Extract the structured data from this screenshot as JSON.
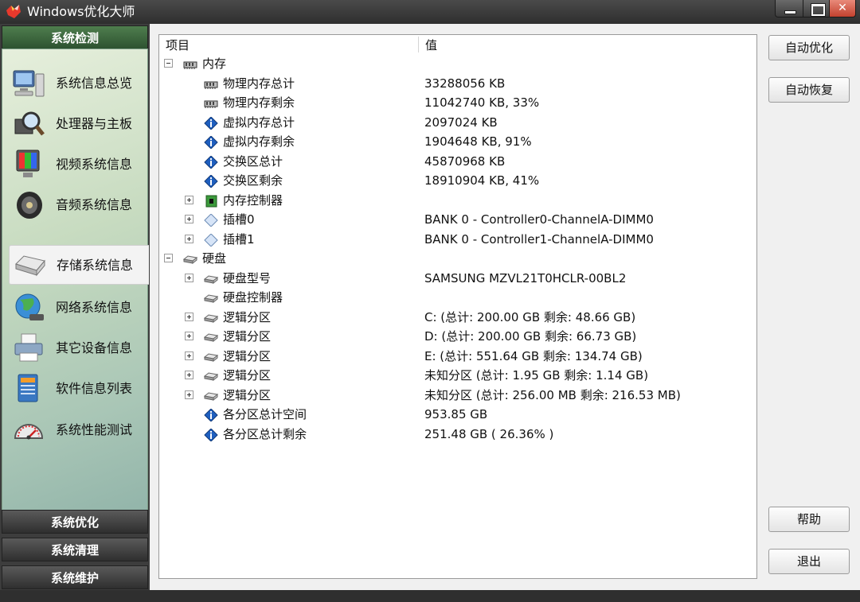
{
  "window": {
    "title": "Windows优化大师",
    "controls": [
      "minimize",
      "maximize",
      "close"
    ]
  },
  "sidebar": {
    "categories": [
      {
        "label": "系统检测",
        "active": true
      },
      {
        "label": "系统优化",
        "active": false
      },
      {
        "label": "系统清理",
        "active": false
      },
      {
        "label": "系统维护",
        "active": false
      }
    ],
    "items": [
      {
        "label": "系统信息总览",
        "icon": "computer-icon",
        "selected": false
      },
      {
        "label": "处理器与主板",
        "icon": "magnifier-chip-icon",
        "selected": false
      },
      {
        "label": "视频系统信息",
        "icon": "monitor-icon",
        "selected": false
      },
      {
        "label": "音频系统信息",
        "icon": "speaker-icon",
        "selected": false
      },
      {
        "label": "存储系统信息",
        "icon": "drive-icon",
        "selected": true
      },
      {
        "label": "网络系统信息",
        "icon": "globe-network-icon",
        "selected": false
      },
      {
        "label": "其它设备信息",
        "icon": "printer-icon",
        "selected": false
      },
      {
        "label": "软件信息列表",
        "icon": "software-box-icon",
        "selected": false
      },
      {
        "label": "系统性能测试",
        "icon": "gauge-icon",
        "selected": false
      }
    ]
  },
  "tree": {
    "columns": [
      "项目",
      "值"
    ],
    "rows": [
      {
        "label": "内存",
        "value": "",
        "level": 0,
        "expander": "minus",
        "icon": "memory-icon"
      },
      {
        "label": "物理内存总计",
        "value": "33288056 KB",
        "level": 1,
        "expander": "",
        "icon": "memory-icon"
      },
      {
        "label": "物理内存剩余",
        "value": "11042740 KB, 33%",
        "level": 1,
        "expander": "",
        "icon": "memory-icon"
      },
      {
        "label": "虚拟内存总计",
        "value": "2097024 KB",
        "level": 1,
        "expander": "",
        "icon": "info-icon"
      },
      {
        "label": "虚拟内存剩余",
        "value": "1904648 KB, 91%",
        "level": 1,
        "expander": "",
        "icon": "info-icon"
      },
      {
        "label": "交换区总计",
        "value": "45870968 KB",
        "level": 1,
        "expander": "",
        "icon": "info-icon"
      },
      {
        "label": "交换区剩余",
        "value": "18910904 KB, 41%",
        "level": 1,
        "expander": "",
        "icon": "info-icon"
      },
      {
        "label": "内存控制器",
        "value": "",
        "level": 1,
        "expander": "plus",
        "icon": "chip-icon"
      },
      {
        "label": "插槽0",
        "value": "BANK 0 - Controller0-ChannelA-DIMM0",
        "level": 1,
        "expander": "plus",
        "icon": "diamond-icon"
      },
      {
        "label": "插槽1",
        "value": "BANK 0 - Controller1-ChannelA-DIMM0",
        "level": 1,
        "expander": "plus",
        "icon": "diamond-icon"
      },
      {
        "label": "硬盘",
        "value": "",
        "level": 0,
        "expander": "minus",
        "icon": "hdd-icon"
      },
      {
        "label": "硬盘型号",
        "value": "SAMSUNG MZVL21T0HCLR-00BL2",
        "level": 1,
        "expander": "plus",
        "icon": "hdd-icon"
      },
      {
        "label": "硬盘控制器",
        "value": "",
        "level": 1,
        "expander": "",
        "icon": "hdd-icon"
      },
      {
        "label": "逻辑分区",
        "value": "C: (总计: 200.00 GB 剩余: 48.66 GB)",
        "level": 1,
        "expander": "plus",
        "icon": "hdd-icon"
      },
      {
        "label": "逻辑分区",
        "value": "D: (总计: 200.00 GB 剩余: 66.73 GB)",
        "level": 1,
        "expander": "plus",
        "icon": "hdd-icon"
      },
      {
        "label": "逻辑分区",
        "value": "E: (总计: 551.64 GB 剩余: 134.74 GB)",
        "level": 1,
        "expander": "plus",
        "icon": "hdd-icon"
      },
      {
        "label": "逻辑分区",
        "value": "未知分区 (总计: 1.95 GB 剩余: 1.14 GB)",
        "level": 1,
        "expander": "plus",
        "icon": "hdd-icon"
      },
      {
        "label": "逻辑分区",
        "value": "未知分区 (总计: 256.00 MB 剩余: 216.53 MB)",
        "level": 1,
        "expander": "plus",
        "icon": "hdd-icon"
      },
      {
        "label": "各分区总计空间",
        "value": "953.85 GB",
        "level": 1,
        "expander": "",
        "icon": "info-icon"
      },
      {
        "label": "各分区总计剩余",
        "value": "251.48 GB ( 26.36% )",
        "level": 1,
        "expander": "",
        "icon": "info-icon"
      }
    ]
  },
  "buttons": {
    "auto_optimize": "自动优化",
    "auto_restore": "自动恢复",
    "help": "帮助",
    "exit": "退出"
  },
  "colors": {
    "info_blue": "#1f5fbf",
    "active_category": "#3f6b40",
    "dark_chrome": "#3a3a3a"
  }
}
